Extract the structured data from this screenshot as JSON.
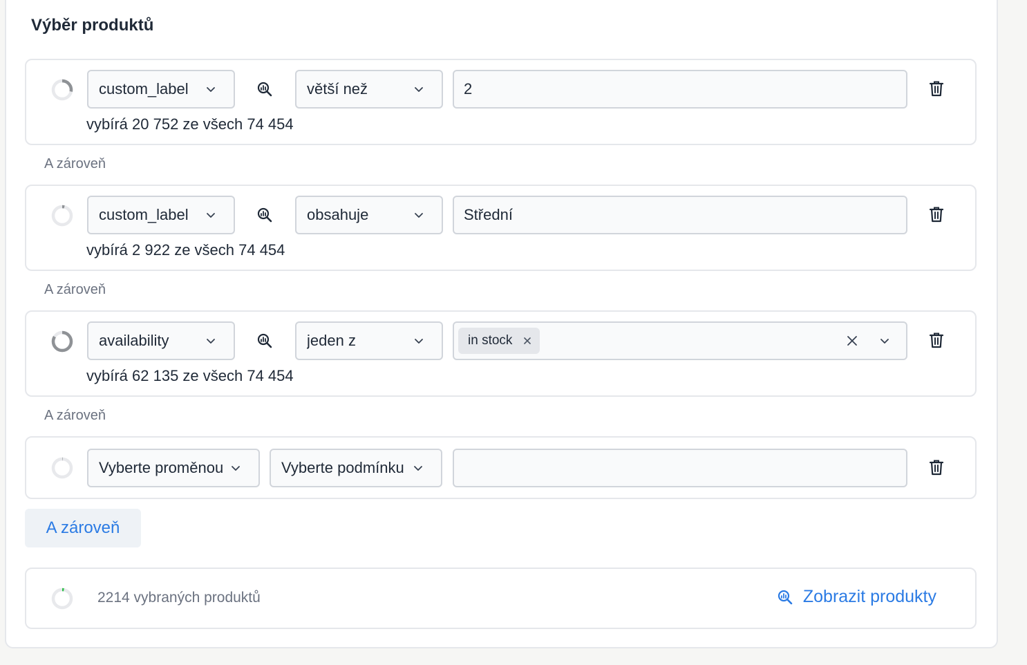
{
  "section_title": "Výběr produktů",
  "rules": [
    {
      "variable": "custom_label",
      "condition": "větší než",
      "value": "2",
      "count_text": "vybírá 20 752 ze všech 74 454",
      "selected_fraction": 0.279
    },
    {
      "variable": "custom_label",
      "condition": "obsahuje",
      "value": "Střední",
      "count_text": "vybírá 2 922 ze všech 74 454",
      "selected_fraction": 0.039
    },
    {
      "variable": "availability",
      "condition": "jeden z",
      "tags": [
        "in stock"
      ],
      "count_text": "vybírá 62 135 ze všech 74 454",
      "selected_fraction": 0.835
    },
    {
      "variable": "Vyberte proměnou",
      "condition": "Vyberte podmínku",
      "value": "",
      "selected_fraction": 0
    }
  ],
  "conjunction_label": "A zároveň",
  "add_condition_label": "A zároveň",
  "summary": {
    "count_text": "2214 vybraných produktů",
    "selected_fraction": 0.03,
    "show_products_label": "Zobrazit produkty"
  },
  "colors": {
    "accent": "#2b7be4",
    "ring_track": "#e8e9ec",
    "ring_fill": "#8f9296",
    "ring_green": "#2fbf4a"
  }
}
